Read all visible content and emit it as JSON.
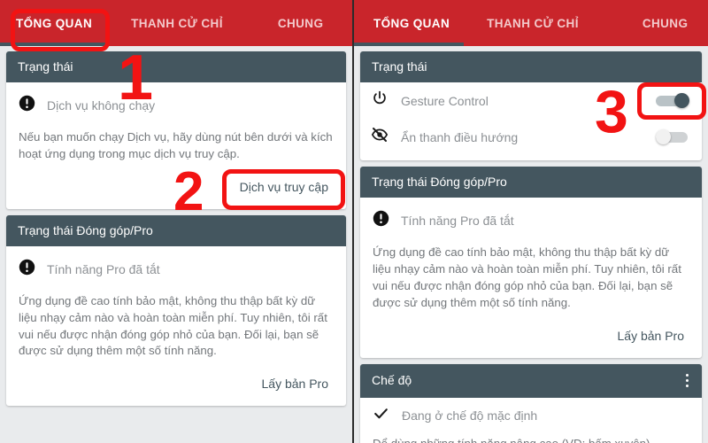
{
  "theme": {
    "tabbar_red": "#c9252b",
    "header_slate": "#44565f",
    "annotation_red": "#f21313",
    "page_background": "#e9ebed",
    "card_background": "#ffffff",
    "muted_text": "#8c9094"
  },
  "tabs": [
    {
      "label": "TỔNG QUAN",
      "active": true
    },
    {
      "label": "THANH CỬ CHỈ",
      "active": false
    },
    {
      "label": "CHUNG",
      "active": false
    }
  ],
  "left_screen": {
    "status_card": {
      "header": "Trạng thái",
      "status_icon": "exclamation-circle-icon",
      "status_text": "Dịch vụ không chạy",
      "paragraph": "Nếu bạn muốn chạy Dịch vụ, hãy dùng nút bên dưới và kích hoạt ứng dụng trong mục dịch vụ truy cập.",
      "action_label": "Dịch vụ truy cập"
    },
    "pro_card": {
      "header": "Trạng thái Đóng góp/Pro",
      "status_icon": "exclamation-circle-icon",
      "status_text": "Tính năng Pro đã tắt",
      "paragraph": "Ứng dụng đề cao tính bảo mật, không thu thập bất kỳ dữ liệu nhạy cảm nào và hoàn toàn miễn phí. Tuy nhiên, tôi rất vui nếu được nhận đóng góp nhỏ của bạn. Đối lại, bạn sẽ được sử dụng thêm một số tính năng.",
      "action_label": "Lấy bản Pro"
    }
  },
  "right_screen": {
    "status_card": {
      "header": "Trạng thái",
      "rows": [
        {
          "icon": "power-icon",
          "label": "Gesture Control",
          "toggle": "on"
        },
        {
          "icon": "eye-off-icon",
          "label": "Ẩn thanh điều hướng",
          "toggle": "off"
        }
      ]
    },
    "pro_card": {
      "header": "Trạng thái Đóng góp/Pro",
      "status_icon": "exclamation-circle-icon",
      "status_text": "Tính năng Pro đã tắt",
      "paragraph": "Ứng dụng đề cao tính bảo mật, không thu thập bất kỳ dữ liệu nhạy cảm nào và hoàn toàn miễn phí. Tuy nhiên, tôi rất vui nếu được nhận đóng góp nhỏ của bạn. Đối lại, bạn sẽ được sử dụng thêm một số tính năng.",
      "action_label": "Lấy bản Pro"
    },
    "mode_card": {
      "header": "Chế độ",
      "overflow_icon": "more-vertical-icon",
      "check_icon": "check-icon",
      "check_label": "Đang ở chế độ mặc định",
      "clipped_text": "Để dùng những tính năng nâng cao (VD: bấm xuyên)"
    }
  },
  "annotations": {
    "step1": "1",
    "step2": "2",
    "step3": "3"
  }
}
